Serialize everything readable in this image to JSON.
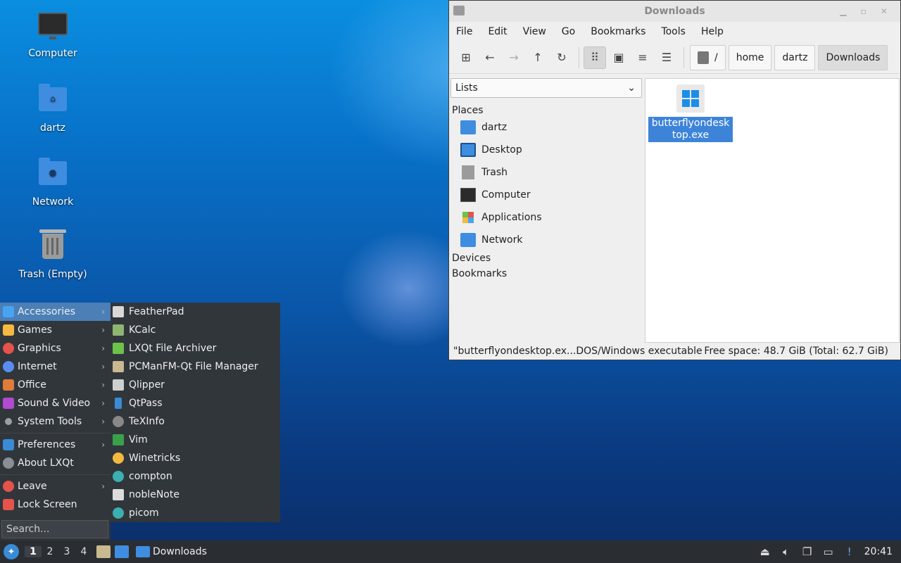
{
  "desktop": {
    "icons": [
      {
        "label": "Computer"
      },
      {
        "label": "dartz"
      },
      {
        "label": "Network"
      },
      {
        "label": "Trash (Empty)"
      }
    ]
  },
  "window": {
    "title": "Downloads",
    "menu": [
      "File",
      "Edit",
      "View",
      "Go",
      "Bookmarks",
      "Tools",
      "Help"
    ],
    "breadcrumbs": [
      "/",
      "home",
      "dartz",
      "Downloads"
    ],
    "side_select": "Lists",
    "sections": {
      "places": "Places",
      "devices": "Devices",
      "bookmarks": "Bookmarks"
    },
    "places": [
      {
        "label": "dartz",
        "icon": "home-folder-icon"
      },
      {
        "label": "Desktop",
        "icon": "desktop-icon"
      },
      {
        "label": "Trash",
        "icon": "trash-icon"
      },
      {
        "label": "Computer",
        "icon": "computer-icon"
      },
      {
        "label": "Applications",
        "icon": "applications-icon"
      },
      {
        "label": "Network",
        "icon": "network-folder-icon"
      }
    ],
    "file": {
      "name": "butterflyondesktop.exe",
      "icon": "windows-exe-icon"
    },
    "status_left": "\"butterflyondesktop.ex...DOS/Windows executable",
    "status_right": "Free space: 48.7 GiB (Total: 62.7 GiB)"
  },
  "start_menu": {
    "categories": [
      {
        "label": "Accessories",
        "color": "#4aa3f0"
      },
      {
        "label": "Games",
        "color": "#f5b841"
      },
      {
        "label": "Graphics",
        "color": "#e5534b"
      },
      {
        "label": "Internet",
        "color": "#5a8df0"
      },
      {
        "label": "Office",
        "color": "#e07b39"
      },
      {
        "label": "Sound & Video",
        "color": "#b04ad0"
      },
      {
        "label": "System Tools",
        "color": "#9aa0a6"
      },
      {
        "label": "Preferences",
        "color": "#3a8bd6"
      },
      {
        "label": "About LXQt",
        "color": "#8a8f95"
      },
      {
        "label": "Leave",
        "color": "#e5534b"
      },
      {
        "label": "Lock Screen",
        "color": "#e5534b"
      }
    ],
    "search_placeholder": "Search...",
    "accessories": [
      {
        "label": "FeatherPad",
        "color": "#d8d8d8"
      },
      {
        "label": "KCalc",
        "color": "#8fb573"
      },
      {
        "label": "LXQt File Archiver",
        "color": "#6cc24a"
      },
      {
        "label": "PCManFM-Qt File Manager",
        "color": "#c9b98f"
      },
      {
        "label": "Qlipper",
        "color": "#cfcfcf"
      },
      {
        "label": "QtPass",
        "color": "#3a8bd6"
      },
      {
        "label": "TeXInfo",
        "color": "#888888"
      },
      {
        "label": "Vim",
        "color": "#3aa04a"
      },
      {
        "label": "Winetricks",
        "color": "#f5b841"
      },
      {
        "label": "compton",
        "color": "#3ab0b0"
      },
      {
        "label": "nobleNote",
        "color": "#dcdcdc"
      },
      {
        "label": "picom",
        "color": "#3ab0b0"
      }
    ]
  },
  "taskbar": {
    "workspaces": [
      "1",
      "2",
      "3",
      "4"
    ],
    "task_label": "Downloads",
    "clock": "20:41"
  }
}
